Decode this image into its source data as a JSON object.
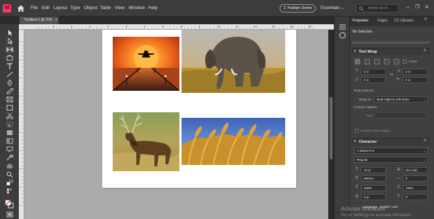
{
  "app": {
    "logo_text": "Id"
  },
  "menu": [
    "File",
    "Edit",
    "Layout",
    "Type",
    "Object",
    "Table",
    "View",
    "Window",
    "Help"
  ],
  "header": {
    "publish_label": "Publish Online",
    "workspace_label": "Essentials",
    "search_placeholder": "Adobe Stock"
  },
  "doc_tab": {
    "label": "*Untitled-2 @ 75%"
  },
  "ruler": {
    "h_labels": [
      "8",
      "6",
      "4",
      "2",
      "0",
      "2",
      "4",
      "6",
      "8",
      "10",
      "12",
      "14",
      "16",
      "18",
      "20"
    ]
  },
  "images": [
    {
      "subject": "sunset pier with airplane"
    },
    {
      "subject": "african elephant"
    },
    {
      "subject": "elk in grass"
    },
    {
      "subject": "wheat field"
    }
  ],
  "panel": {
    "tabs": [
      "Properties",
      "Pages",
      "CC Libraries"
    ],
    "selection": "No Selection",
    "text_wrap": {
      "title": "Text Wrap",
      "invert_label": "Invert",
      "top": "0 in",
      "bottom": "0 in",
      "left": "0 in",
      "right": "0 in",
      "wrap_options_label": "Wrap Options:",
      "wrap_to_label": "Wrap To:",
      "wrap_to_value": "Both Right & Left Sides",
      "contour_label": "Contour Options:",
      "type_label": "Type:",
      "include_label": "Include Inside Edges"
    },
    "character": {
      "title": "Character",
      "font_family": "Minion Pro",
      "font_style": "Regular",
      "font_size": "12 pt",
      "leading": "(14.4 pt)",
      "kerning": "Metrics",
      "tracking": "0",
      "vscale": "100%",
      "hscale": "100%",
      "baseline": "0 pt",
      "skew": "0°",
      "language_label": "Language:",
      "language_value": "English: USA"
    }
  },
  "watermark": {
    "line1": "Activate Windows",
    "line2": "Go to Settings to activate Windows."
  },
  "colors": {
    "accent": "#ff3366",
    "ui_dark": "#323232",
    "canvas": "#ababab"
  }
}
